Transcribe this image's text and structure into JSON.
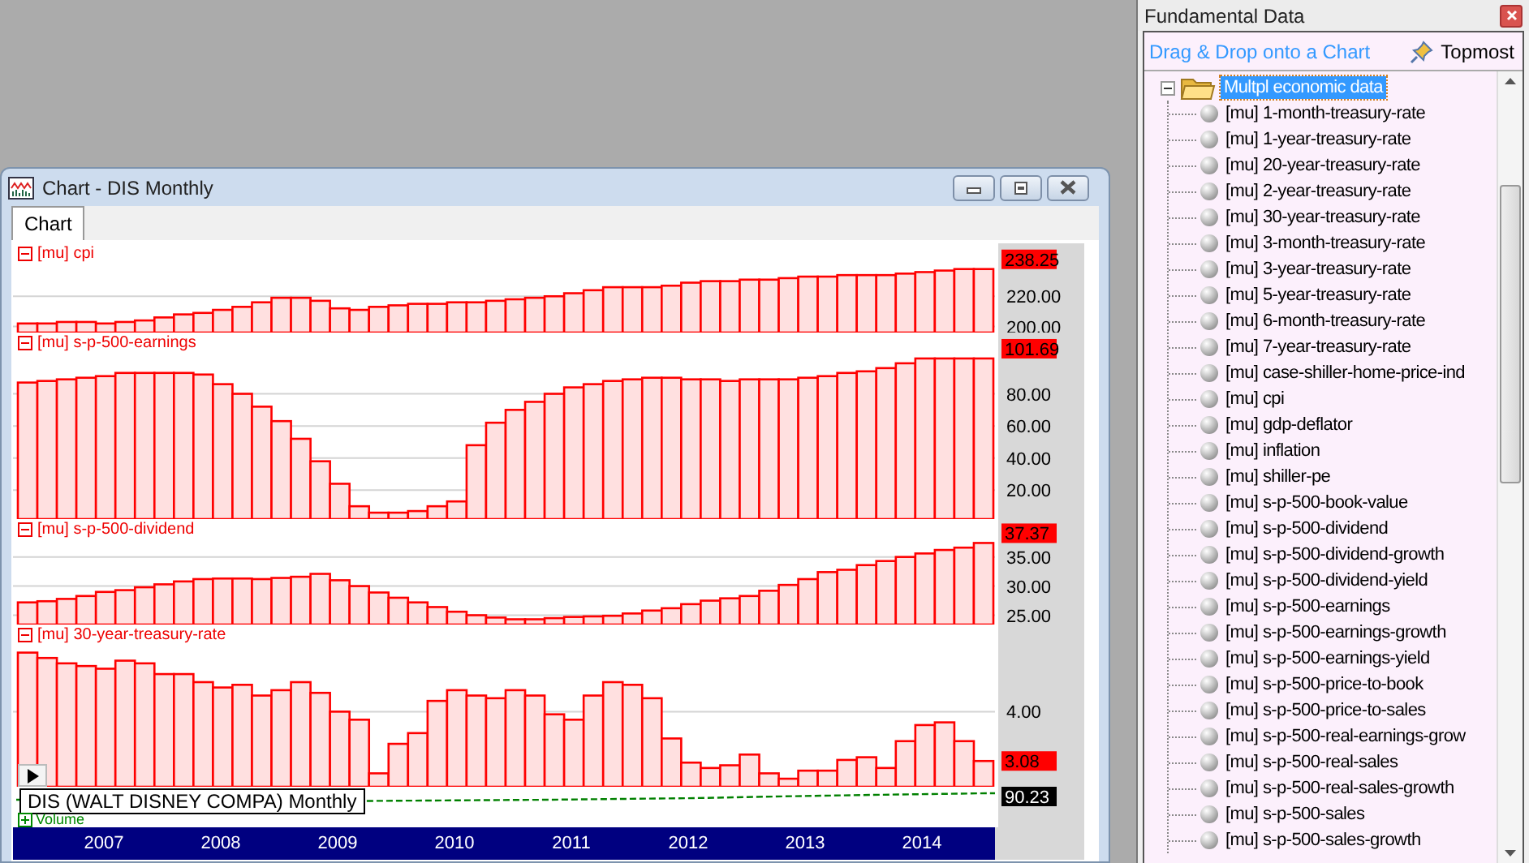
{
  "chart_window": {
    "title": "Chart - DIS Monthly",
    "tabs": [
      {
        "label": "Chart",
        "selected": true
      }
    ],
    "panes": [
      {
        "title": "[mu] cpi",
        "expanded": true,
        "last_value": "238.25",
        "chart_data": {
          "type": "bar",
          "grid": true,
          "ylim": [
            196,
            240
          ],
          "yticks": [
            {
              "value": 200,
              "label": "200.00"
            },
            {
              "value": 220,
              "label": "220.00"
            }
          ],
          "values": [
            202,
            202,
            203,
            203,
            202,
            203,
            204,
            206,
            208,
            209,
            211,
            213,
            216,
            219,
            219,
            217,
            212,
            211,
            213,
            214,
            215,
            215,
            216,
            216,
            217,
            218,
            219,
            220,
            222,
            224,
            226,
            226,
            226,
            227,
            229,
            230,
            230,
            231,
            231,
            232,
            233,
            233,
            234,
            234,
            234,
            235,
            236,
            237,
            238,
            238
          ]
        }
      },
      {
        "title": "[mu] s-p-500-earnings",
        "expanded": true,
        "last_value": "101.69",
        "chart_data": {
          "type": "bar",
          "grid": true,
          "ylim": [
            2,
            104
          ],
          "yticks": [
            {
              "value": 20,
              "label": "20.00"
            },
            {
              "value": 40,
              "label": "40.00"
            },
            {
              "value": 60,
              "label": "60.00"
            },
            {
              "value": 80,
              "label": "80.00"
            }
          ],
          "values": [
            87,
            88,
            89,
            90,
            91,
            93,
            93,
            93,
            93,
            92,
            86,
            80,
            72,
            63,
            52,
            38,
            24,
            10,
            6,
            6,
            7,
            10,
            13,
            48,
            62,
            70,
            75,
            80,
            84,
            86,
            88,
            89,
            90,
            90,
            89,
            89,
            88,
            89,
            89,
            89,
            90,
            91,
            93,
            94,
            96,
            99,
            102,
            102,
            102,
            102
          ]
        }
      },
      {
        "title": "[mu] s-p-500-dividend",
        "expanded": true,
        "last_value": "37.37",
        "chart_data": {
          "type": "bar",
          "grid": true,
          "ylim": [
            23.4,
            37.6
          ],
          "yticks": [
            {
              "value": 25,
              "label": "25.00"
            },
            {
              "value": 30,
              "label": "30.00"
            },
            {
              "value": 35,
              "label": "35.00"
            }
          ],
          "values": [
            27.2,
            27.4,
            27.8,
            28.3,
            29,
            29.3,
            29.8,
            30.3,
            30.8,
            31.2,
            31.3,
            31.3,
            31.2,
            31.4,
            31.6,
            32.1,
            31,
            30,
            28.9,
            28,
            27.2,
            26.4,
            25.6,
            25,
            24.6,
            24.3,
            24.3,
            24.5,
            24.7,
            24.8,
            24.9,
            25.3,
            25.8,
            26.2,
            26.9,
            27.5,
            27.9,
            28.3,
            29.2,
            30.2,
            31.2,
            32.4,
            32.8,
            33.6,
            34.3,
            35,
            35.6,
            36.2,
            36.6,
            37.4
          ]
        }
      },
      {
        "title": "[mu] 30-year-treasury-rate",
        "expanded": true,
        "last_value": "3.08",
        "axis_label": "4.00"
      }
    ],
    "tooltip": "DIS (WALT DISNEY COMPA) Monthly",
    "volume": {
      "title": "Volume",
      "expanded": false,
      "last_value": "90.23"
    },
    "time_axis": [
      "2007",
      "2008",
      "2009",
      "2010",
      "2011",
      "2012",
      "2013",
      "2014"
    ]
  },
  "fundamental_panel": {
    "title": "Fundamental Data",
    "link": "Drag & Drop onto a Chart",
    "topmost": "Topmost",
    "tree": [
      {
        "label": "Multpl economic data",
        "selected": true,
        "expanded": true,
        "children": [
          {
            "label": "[mu] 1-month-treasury-rate",
            "selected": false
          },
          {
            "label": "[mu] 1-year-treasury-rate",
            "selected": false
          },
          {
            "label": "[mu] 20-year-treasury-rate",
            "selected": false
          },
          {
            "label": "[mu] 2-year-treasury-rate",
            "selected": false
          },
          {
            "label": "[mu] 30-year-treasury-rate",
            "selected": false
          },
          {
            "label": "[mu] 3-month-treasury-rate",
            "selected": false
          },
          {
            "label": "[mu] 3-year-treasury-rate",
            "selected": false
          },
          {
            "label": "[mu] 5-year-treasury-rate",
            "selected": false
          },
          {
            "label": "[mu] 6-month-treasury-rate",
            "selected": false
          },
          {
            "label": "[mu] 7-year-treasury-rate",
            "selected": false
          },
          {
            "label": "[mu] case-shiller-home-price-ind",
            "selected": false
          },
          {
            "label": "[mu] cpi",
            "selected": false
          },
          {
            "label": "[mu] gdp-deflator",
            "selected": false
          },
          {
            "label": "[mu] inflation",
            "selected": false
          },
          {
            "label": "[mu] shiller-pe",
            "selected": false
          },
          {
            "label": "[mu] s-p-500-book-value",
            "selected": false
          },
          {
            "label": "[mu] s-p-500-dividend",
            "selected": false
          },
          {
            "label": "[mu] s-p-500-dividend-growth",
            "selected": false
          },
          {
            "label": "[mu] s-p-500-dividend-yield",
            "selected": false
          },
          {
            "label": "[mu] s-p-500-earnings",
            "selected": false
          },
          {
            "label": "[mu] s-p-500-earnings-growth",
            "selected": false
          },
          {
            "label": "[mu] s-p-500-earnings-yield",
            "selected": false
          },
          {
            "label": "[mu] s-p-500-price-to-book",
            "selected": false
          },
          {
            "label": "[mu] s-p-500-price-to-sales",
            "selected": false
          },
          {
            "label": "[mu] s-p-500-real-earnings-grow",
            "selected": false
          },
          {
            "label": "[mu] s-p-500-real-sales",
            "selected": false
          },
          {
            "label": "[mu] s-p-500-real-sales-growth",
            "selected": false
          },
          {
            "label": "[mu] s-p-500-sales",
            "selected": false
          },
          {
            "label": "[mu] s-p-500-sales-growth",
            "selected": false
          }
        ]
      }
    ]
  }
}
